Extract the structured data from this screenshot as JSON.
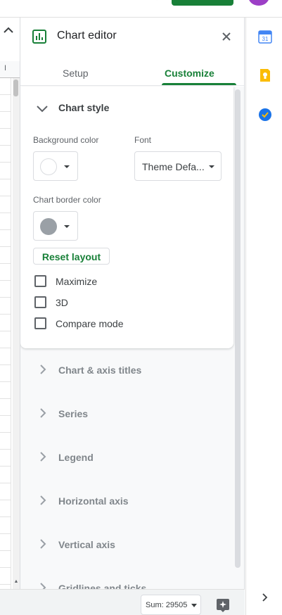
{
  "editor": {
    "title": "Chart editor",
    "tabs": [
      {
        "label": "Setup",
        "active": false
      },
      {
        "label": "Customize",
        "active": true
      }
    ]
  },
  "chart_style": {
    "title": "Chart style",
    "background_color_label": "Background color",
    "background_color_value": "#ffffff",
    "font_label": "Font",
    "font_value": "Theme Defa...",
    "border_color_label": "Chart border color",
    "border_color_value": "#9aa0a6",
    "reset_label": "Reset layout",
    "checkboxes": [
      {
        "label": "Maximize",
        "checked": false
      },
      {
        "label": "3D",
        "checked": false
      },
      {
        "label": "Compare mode",
        "checked": false
      }
    ]
  },
  "sections": [
    {
      "label": "Chart & axis titles"
    },
    {
      "label": "Series"
    },
    {
      "label": "Legend"
    },
    {
      "label": "Horizontal axis"
    },
    {
      "label": "Vertical axis"
    },
    {
      "label": "Gridlines and ticks"
    }
  ],
  "status": {
    "sum_label": "Sum: 29505"
  },
  "grid": {
    "column_header": "I"
  },
  "icons": {
    "chart": "bar-chart-icon",
    "close": "close-icon",
    "calendar": "calendar-icon",
    "keep": "keep-icon",
    "tasks": "tasks-icon",
    "explore": "explore-icon"
  },
  "colors": {
    "accent": "#188038",
    "avatar": "#9c3fc6",
    "calendar": "#4285f4",
    "keep": "#fbbc04",
    "tasks": "#1a73e8"
  }
}
